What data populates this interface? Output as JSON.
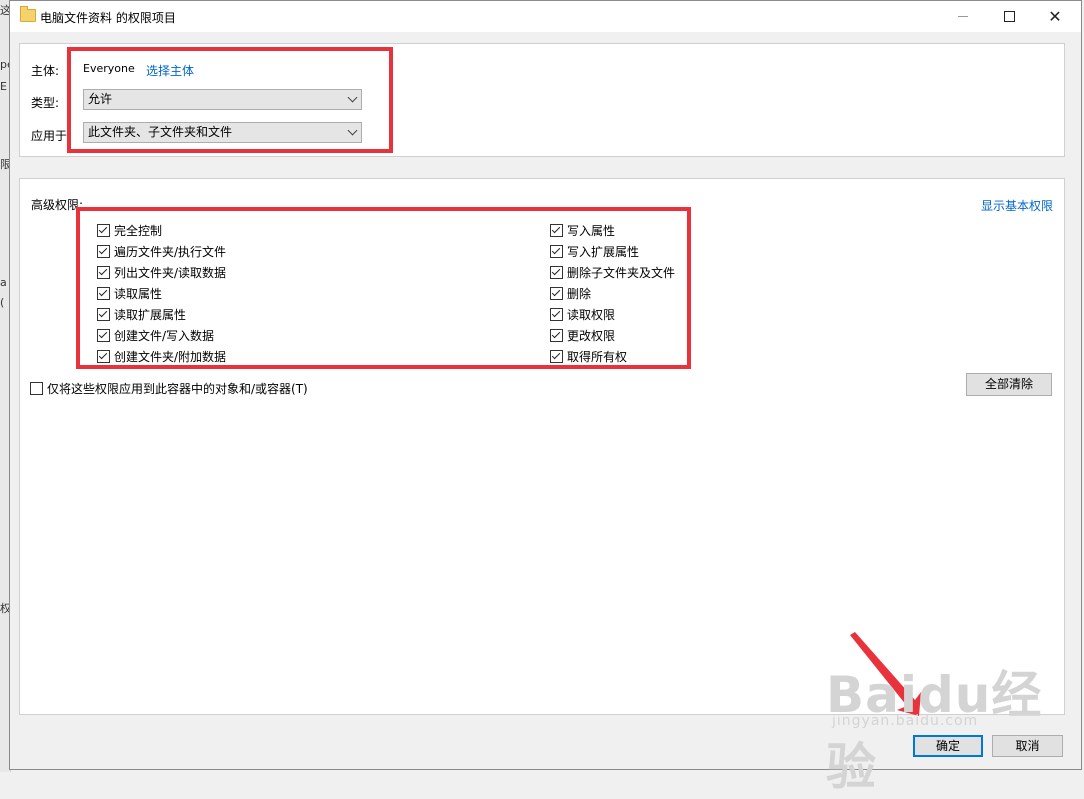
{
  "window": {
    "title": "电脑文件资料 的权限项目"
  },
  "principal": {
    "label": "主体:",
    "value": "Everyone",
    "select_link": "选择主体"
  },
  "type": {
    "label": "类型:",
    "value": "允许"
  },
  "applies_to": {
    "label": "应用于",
    "value": "此文件夹、子文件夹和文件"
  },
  "advanced": {
    "title": "高级权限:",
    "show_basic_link": "显示基本权限",
    "left": [
      {
        "label": "完全控制",
        "checked": true
      },
      {
        "label": "遍历文件夹/执行文件",
        "checked": true
      },
      {
        "label": "列出文件夹/读取数据",
        "checked": true
      },
      {
        "label": "读取属性",
        "checked": true
      },
      {
        "label": "读取扩展属性",
        "checked": true
      },
      {
        "label": "创建文件/写入数据",
        "checked": true
      },
      {
        "label": "创建文件夹/附加数据",
        "checked": true
      }
    ],
    "right": [
      {
        "label": "写入属性",
        "checked": true
      },
      {
        "label": "写入扩展属性",
        "checked": true
      },
      {
        "label": "删除子文件夹及文件",
        "checked": true
      },
      {
        "label": "删除",
        "checked": true
      },
      {
        "label": "读取权限",
        "checked": true
      },
      {
        "label": "更改权限",
        "checked": true
      },
      {
        "label": "取得所有权",
        "checked": true
      }
    ],
    "apply_only_label": "仅将这些权限应用到此容器中的对象和/或容器(T)",
    "apply_only_checked": false,
    "clear_all": "全部清除"
  },
  "footer": {
    "ok": "确定",
    "cancel": "取消"
  },
  "watermark": {
    "brand": "Baidu经验",
    "url": "jingyan.baidu.com"
  },
  "background_fragments": [
    "这",
    "pe",
    "E",
    "限",
    "a",
    "(",
    "权"
  ],
  "colors": {
    "accent": "#0078d7",
    "link": "#0066cc",
    "annotation": "#e8323c"
  }
}
